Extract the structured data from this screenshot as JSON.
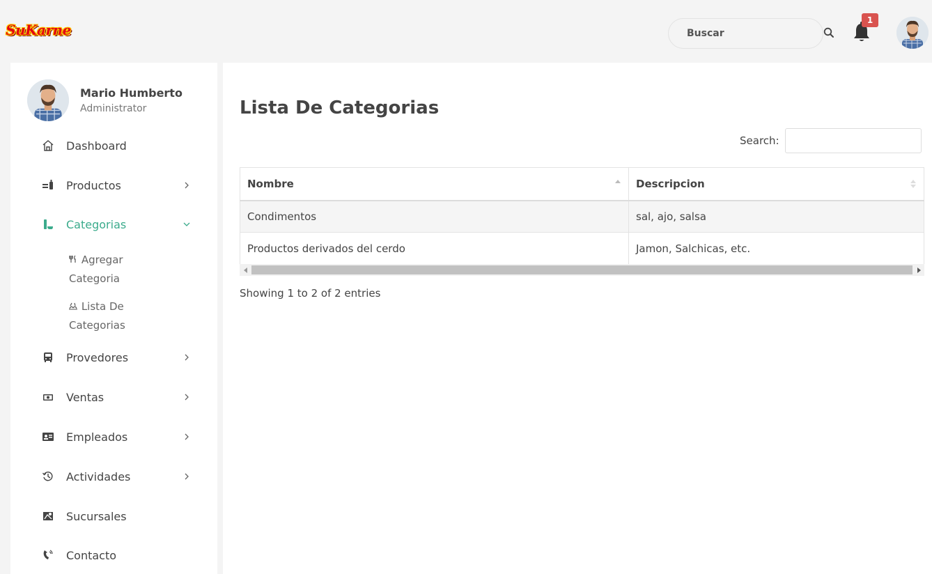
{
  "header": {
    "logo_text": "SuKarne",
    "search_placeholder": "Buscar",
    "notifications_count": "1"
  },
  "sidebar": {
    "profile": {
      "name": "Mario Humberto",
      "role": "Administrator"
    },
    "items": [
      {
        "label": "Dashboard",
        "icon": "home-icon",
        "has_children": false,
        "active": false
      },
      {
        "label": "Productos",
        "icon": "products-icon",
        "has_children": true,
        "active": false
      },
      {
        "label": "Categorias",
        "icon": "bottle-icon",
        "has_children": true,
        "active": true,
        "expanded": true
      },
      {
        "label": "Provedores",
        "icon": "bus-icon",
        "has_children": true,
        "active": false
      },
      {
        "label": "Ventas",
        "icon": "money-icon",
        "has_children": true,
        "active": false
      },
      {
        "label": "Empleados",
        "icon": "id-card-icon",
        "has_children": true,
        "active": false
      },
      {
        "label": "Actividades",
        "icon": "history-icon",
        "has_children": true,
        "active": false
      },
      {
        "label": "Sucursales",
        "icon": "map-icon",
        "has_children": false,
        "active": false
      },
      {
        "label": "Contacto",
        "icon": "phone-icon",
        "has_children": false,
        "active": false
      }
    ],
    "submenu": [
      {
        "label": "Agregar Categoria",
        "icon": "utensils-icon"
      },
      {
        "label": "Lista De Categorias",
        "icon": "dishes-icon"
      }
    ],
    "accent_color": "#3bab8c"
  },
  "main": {
    "title": "Lista De Categorias",
    "search_label": "Search:",
    "search_value": "",
    "table": {
      "columns": [
        "Nombre",
        "Descripcion"
      ],
      "rows": [
        [
          "Condimentos",
          "sal, ajo, salsa"
        ],
        [
          "Productos derivados del cerdo",
          "Jamon, Salchicas, etc."
        ]
      ]
    },
    "info": "Showing 1 to 2 of 2 entries"
  }
}
